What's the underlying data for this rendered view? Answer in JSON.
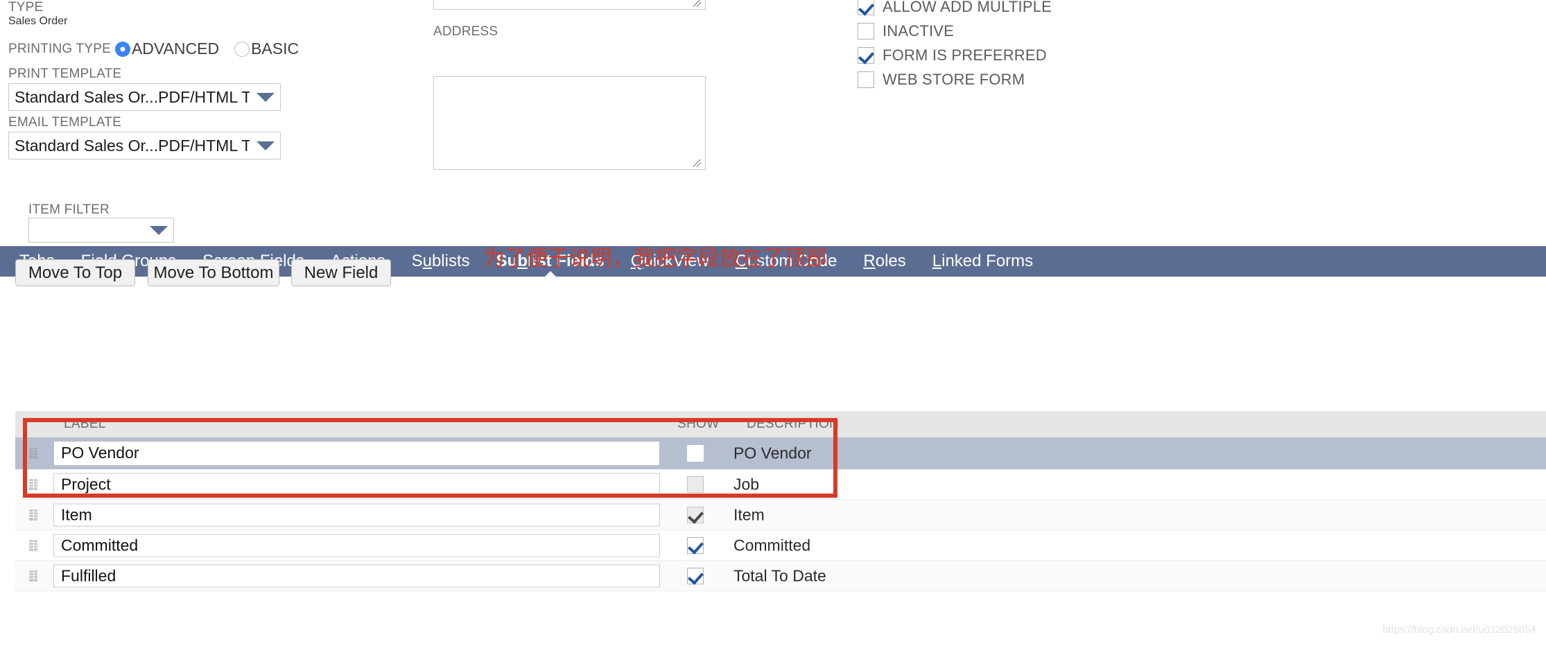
{
  "form": {
    "type_label": "TYPE",
    "type_value": "Sales Order",
    "printing_type_label": "PRINTING TYPE",
    "printing_type_options": [
      {
        "label": "ADVANCED",
        "selected": true
      },
      {
        "label": "BASIC",
        "selected": false
      }
    ],
    "print_template_label": "PRINT TEMPLATE",
    "print_template_value": "Standard Sales Or...PDF/HTML Template",
    "email_template_label": "EMAIL TEMPLATE",
    "email_template_value": "Standard Sales Or...PDF/HTML Template",
    "address_label": "ADDRESS",
    "address_value": "",
    "top_textarea_value": ""
  },
  "options": {
    "checkboxes": [
      {
        "label": "ALLOW ADD MULTIPLE",
        "checked": true,
        "disabled": false
      },
      {
        "label": "INACTIVE",
        "checked": false,
        "disabled": false
      },
      {
        "label": "FORM IS PREFERRED",
        "checked": true,
        "disabled": false
      },
      {
        "label": "WEB STORE FORM",
        "checked": false,
        "disabled": false
      }
    ]
  },
  "tabs": [
    {
      "label": "Tabs",
      "accel": "T",
      "active": false
    },
    {
      "label": "Field Groups",
      "accel": "F",
      "active": false
    },
    {
      "label": "Screen Fields",
      "accel": "S",
      "active": false
    },
    {
      "label": "Actions",
      "accel": "A",
      "active": false
    },
    {
      "label": "Sublists",
      "accel": "u",
      "active": false
    },
    {
      "label": "Sublist Fields",
      "accel": "b",
      "active": true
    },
    {
      "label": "QuickView",
      "accel": "Q",
      "active": false
    },
    {
      "label": "Custom Code",
      "accel": "C",
      "active": false
    },
    {
      "label": "Roles",
      "accel": "R",
      "active": false
    },
    {
      "label": "Linked Forms",
      "accel": "L",
      "active": false
    }
  ],
  "toolbar": {
    "item_filter_label": "ITEM FILTER",
    "item_filter_value": "",
    "move_to_top": "Move To Top",
    "move_to_bottom": "Move To Bottom",
    "new_field": "New Field"
  },
  "annotation": "为了便于说明，我把字段放在了顶部",
  "grid": {
    "columns": [
      "LABEL",
      "SHOW",
      "DESCRIPTION"
    ],
    "rows": [
      {
        "label": "PO Vendor",
        "show": false,
        "show_disabled": false,
        "description": "PO Vendor",
        "selected": true
      },
      {
        "label": "Project",
        "show": false,
        "show_disabled": true,
        "description": "Job",
        "selected": false
      },
      {
        "label": "Item",
        "show": true,
        "show_disabled": true,
        "description": "Item",
        "selected": false
      },
      {
        "label": "Committed",
        "show": true,
        "show_disabled": false,
        "description": "Committed",
        "selected": false
      },
      {
        "label": "Fulfilled",
        "show": true,
        "show_disabled": false,
        "description": "Total To Date",
        "selected": false
      }
    ]
  },
  "watermark": "https://blog.csdn.net/u012025054",
  "colors": {
    "tabbar": "#5b6d93",
    "accent_red": "#d93a26",
    "radio_blue": "#3b82f6",
    "check_blue": "#22559c",
    "selected_row": "#b6bfd0"
  }
}
